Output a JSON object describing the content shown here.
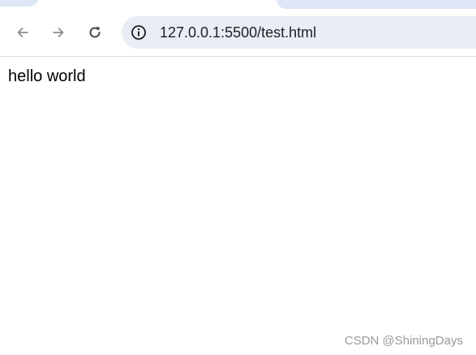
{
  "address_bar": {
    "url": "127.0.0.1:5500/test.html",
    "info_icon": "info-icon"
  },
  "navigation": {
    "back_icon": "arrow-left-icon",
    "forward_icon": "arrow-right-icon",
    "reload_icon": "reload-icon"
  },
  "page": {
    "text": "hello world"
  },
  "watermark": {
    "text": "CSDN @ShiningDays"
  },
  "colors": {
    "omnibox_bg": "#e9edf6",
    "tab_bg": "#dfe6f6",
    "icon_dark": "#474747",
    "icon_light": "#8c8c8c",
    "watermark": "#9a9a9a"
  }
}
